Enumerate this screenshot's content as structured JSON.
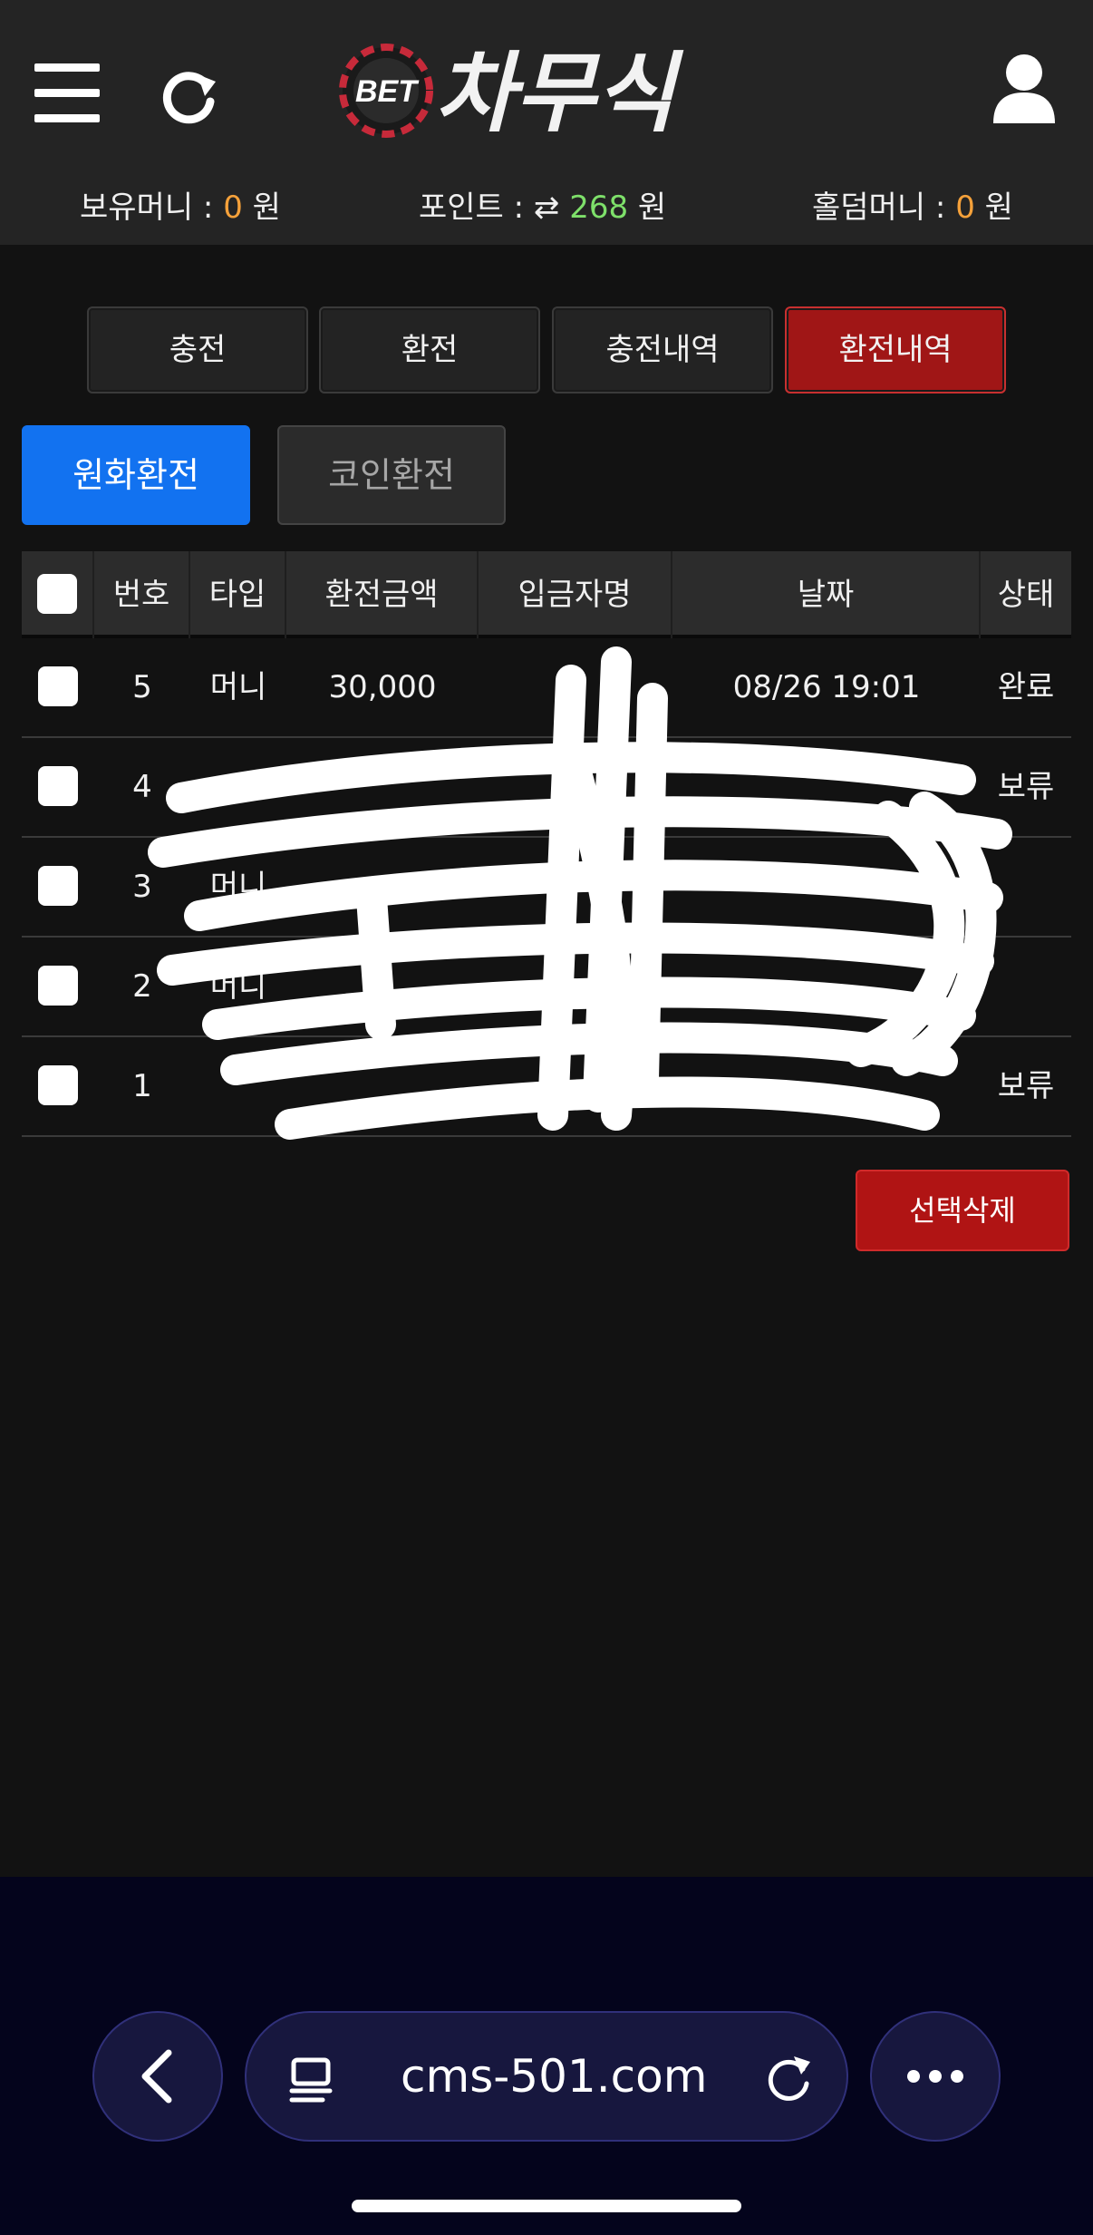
{
  "header": {
    "logo_badge": "BET",
    "logo_text": "차무식",
    "balances": {
      "money_label": "보유머니 : ",
      "money_value": "0",
      "money_unit": " 원",
      "point_label": "포인트 : ",
      "point_value": "268",
      "point_unit": " 원",
      "holdem_label": "홀덤머니 : ",
      "holdem_value": "0",
      "holdem_unit": " 원"
    }
  },
  "main_tabs": [
    {
      "label": "충전",
      "active": false
    },
    {
      "label": "환전",
      "active": false
    },
    {
      "label": "충전내역",
      "active": false
    },
    {
      "label": "환전내역",
      "active": true
    }
  ],
  "sub_tabs": [
    {
      "label": "원화환전",
      "active": true
    },
    {
      "label": "코인환전",
      "active": false
    }
  ],
  "table": {
    "headers": [
      "번호",
      "타입",
      "환전금액",
      "입금자명",
      "날짜",
      "상태"
    ],
    "rows": [
      {
        "num": "5",
        "type": "머니",
        "amount": "30,000",
        "depositor": "",
        "date": "08/26 19:01",
        "status": "완료"
      },
      {
        "num": "4",
        "type": "",
        "amount": "",
        "depositor": "",
        "date": "",
        "status": "보류"
      },
      {
        "num": "3",
        "type": "머니",
        "amount": "",
        "depositor": "",
        "date": "",
        "status": ""
      },
      {
        "num": "2",
        "type": "머니",
        "amount": "",
        "depositor": "",
        "date": "",
        "status": ""
      },
      {
        "num": "1",
        "type": "",
        "amount": "",
        "depositor": "",
        "date": "",
        "status": "보류"
      }
    ]
  },
  "delete_button": "선택삭제",
  "browser": {
    "url": "cms-501.com"
  },
  "colors": {
    "active_tab": "#a01616",
    "active_subtab": "#1272f0",
    "money_value": "#f5a13a",
    "point_value": "#7ee06a"
  }
}
